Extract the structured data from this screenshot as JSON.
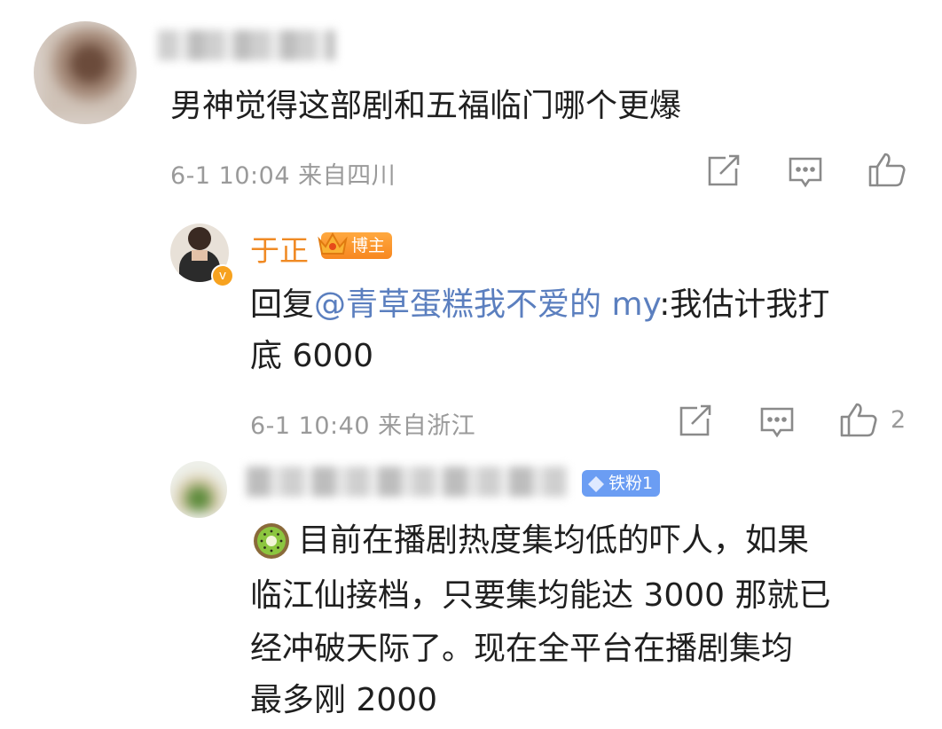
{
  "comment1": {
    "text": "男神觉得这部剧和五福临门哪个更爆",
    "meta": "6-1 10:04 来自四川"
  },
  "reply1": {
    "username": "于正",
    "badge": "博主",
    "reply_prefix": "回复",
    "mention": "@青草蛋糕我不爱的 my",
    "colon_text": ":我估计我打",
    "line2": "底 6000",
    "meta": "6-1 10:40 来自浙江",
    "like_count": "2"
  },
  "reply2": {
    "badge": "铁粉1",
    "lines": [
      "目前在播剧热度集均低的吓人，如果",
      "临江仙接档，只要集均能达 3000 那就已",
      "经冲破天际了。现在全平台在播剧集均",
      "最多刚 2000"
    ]
  },
  "colors": {
    "mention": "#5b7fbf",
    "blogger_name": "#f08a24",
    "fan_badge": "#6b9df3",
    "meta": "#9a9a9a"
  },
  "icons": [
    "share-icon",
    "comment-icon",
    "like-icon",
    "crown-icon",
    "diamond-icon",
    "kiwi-emoji-icon",
    "verified-icon"
  ]
}
